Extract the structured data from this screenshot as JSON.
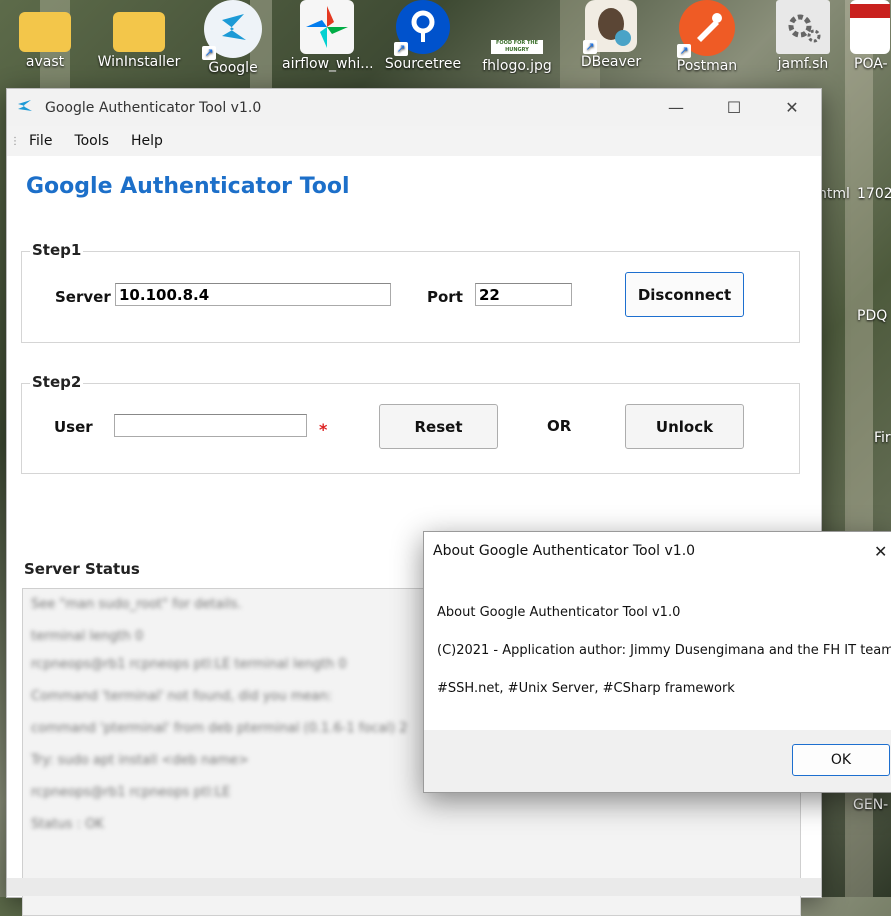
{
  "desktop": {
    "icons": [
      {
        "label": "avast",
        "icon": "folder-icon"
      },
      {
        "label": "WinInstaller",
        "icon": "folder-icon"
      },
      {
        "label": "Google",
        "icon": "google-authenticator-shortcut-icon"
      },
      {
        "label": "airflow_whi...",
        "icon": "airflow-icon"
      },
      {
        "label": "Sourcetree",
        "icon": "sourcetree-icon"
      },
      {
        "label": "fhlogo.jpg",
        "icon": "image-file-icon"
      },
      {
        "label": "DBeaver",
        "icon": "dbeaver-icon"
      },
      {
        "label": "Postman",
        "icon": "postman-icon"
      },
      {
        "label": "jamf.sh",
        "icon": "script-file-icon"
      },
      {
        "label": "POA-",
        "icon": "pdf-file-icon"
      }
    ],
    "right_fragments": {
      "html": "html",
      "num": "1702",
      "pdq": "PDQ",
      "fir": "Fir",
      "gen": "GEN-"
    },
    "logo_text": "FOOD FOR THE HUNGRY"
  },
  "window": {
    "title": "Google Authenticator Tool v1.0",
    "menu": [
      "File",
      "Tools",
      "Help"
    ],
    "heading": "Google Authenticator Tool",
    "step1": {
      "label": "Step1",
      "server_label": "Server",
      "server_value": "10.100.8.4",
      "port_label": "Port",
      "port_value": "22",
      "disconnect_label": "Disconnect"
    },
    "step2": {
      "label": "Step2",
      "user_label": "User",
      "user_value": "",
      "required_mark": "*",
      "reset_label": "Reset",
      "or_label": "OR",
      "unlock_label": "Unlock"
    },
    "server_status_label": "Server Status",
    "status_lines": [
      "See \"man sudo_root\" for details.",
      "terminal length 0",
      "rcpneops@rb1 rcpneops ptl:LE terminal length 0",
      "Command 'terminal' not found, did you mean:",
      "  command 'pterminal' from deb pterminal (0.1.6-1 focal) 2",
      "Try: sudo apt install <deb name>",
      "rcpneops@rb1 rcpneops ptl:LE",
      "Status : OK"
    ]
  },
  "about": {
    "title": "About Google Authenticator Tool v1.0",
    "line1": "About Google Authenticator Tool v1.0",
    "line2": "(C)2021 - Application author: Jimmy Dusengimana and the FH IT team",
    "line3": "#SSH.net, #Unix Server, #CSharp framework",
    "ok_label": "OK"
  }
}
